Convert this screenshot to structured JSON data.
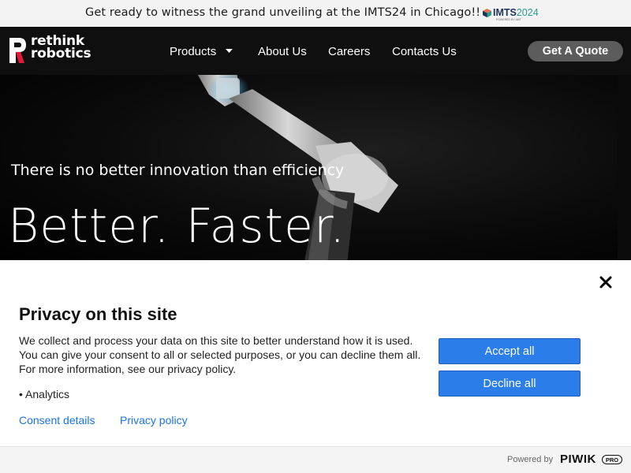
{
  "announcement": {
    "text": "Get ready to witness the grand unveiling at the IMTS24 in Chicago!!",
    "logo_imts": "IMTS",
    "logo_year": "2024",
    "logo_sub": "POWERED BY AMT"
  },
  "header": {
    "logo_line1": "rethink",
    "logo_line2": "robotics",
    "nav": [
      {
        "label": "Products",
        "has_dropdown": true
      },
      {
        "label": "About Us"
      },
      {
        "label": "Careers"
      },
      {
        "label": "Contacts Us"
      }
    ],
    "cta_label": "Get A Quote"
  },
  "hero": {
    "tagline": "There is no better innovation than efficiency",
    "headline": "Better. Faster."
  },
  "consent": {
    "title": "Privacy on this site",
    "body": "We collect and process your data on this site to better understand how it is used. You can give your consent to all or selected purposes, or you can decline them all. For more information, see our privacy policy.",
    "purposes": [
      "Analytics"
    ],
    "links": {
      "details": "Consent details",
      "policy": "Privacy policy"
    },
    "accept_label": "Accept all",
    "decline_label": "Decline all"
  },
  "footer": {
    "powered_by": "Powered by",
    "brand": "PIWIK",
    "brand_badge": "PRO"
  },
  "colors": {
    "accent": "#2b7de9",
    "link": "#1a73e8",
    "logo_red": "#e6193c",
    "nav_bg": "#0f0f0f",
    "cta_bg": "#5c5c5c"
  },
  "icons": {
    "close": "close-icon",
    "caret": "chevron-down-icon",
    "imts": "imts-cube-icon",
    "logo": "rethink-logo-icon"
  }
}
